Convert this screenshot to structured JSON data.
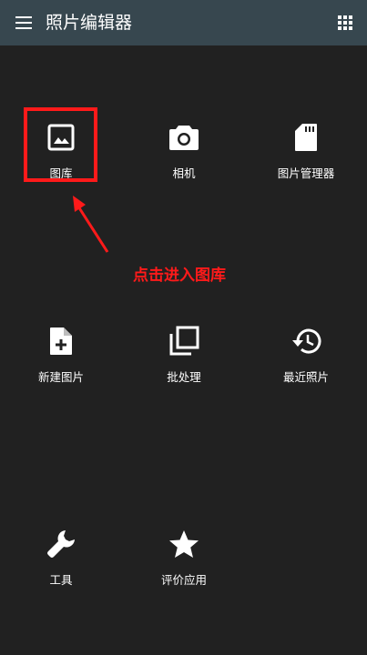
{
  "app_bar": {
    "title": "照片编辑器",
    "menu_icon": "menu-icon",
    "grid_icon": "apps-grid-icon",
    "color": "#37474f"
  },
  "background_color": "#212121",
  "tiles": [
    {
      "label": "图库",
      "icon": "gallery-icon"
    },
    {
      "label": "相机",
      "icon": "camera-icon"
    },
    {
      "label": "图片管理器",
      "icon": "sd-card-icon"
    },
    {
      "label": "新建图片",
      "icon": "new-image-icon"
    },
    {
      "label": "批处理",
      "icon": "batch-icon"
    },
    {
      "label": "最近照片",
      "icon": "history-icon"
    },
    {
      "label": "工具",
      "icon": "wrench-icon"
    },
    {
      "label": "评价应用",
      "icon": "star-icon"
    }
  ],
  "annotation": {
    "text": "点击进入图库",
    "color": "#ff1a1a"
  }
}
